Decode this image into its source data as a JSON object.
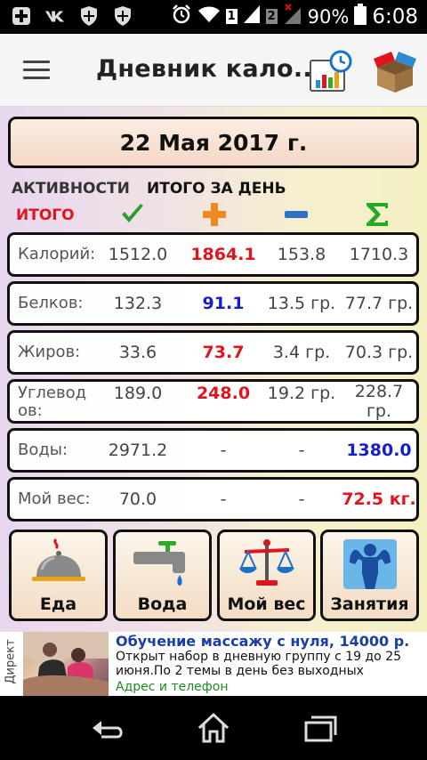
{
  "status_bar": {
    "sim1_badge": "1",
    "sim2_badge": "2",
    "battery": "90%",
    "time": "6:08"
  },
  "app_bar": {
    "title": "Дневник кало..."
  },
  "date": "22 Мая 2017 г.",
  "tabs": {
    "activities": "АКТИВНОСТИ",
    "day_total": "ИТОГО ЗА ДЕНЬ"
  },
  "total_label": "ИТОГО",
  "column_icons": [
    "check-icon",
    "plus-icon",
    "minus-icon",
    "sigma-icon"
  ],
  "rows": [
    {
      "label": "Калорий:",
      "values": [
        "1512.0",
        "1864.1",
        "153.8",
        "1710.3"
      ],
      "colors": [
        "",
        "red",
        "",
        ""
      ]
    },
    {
      "label": "Белков:",
      "values": [
        "132.3",
        "91.1",
        "13.5 гр.",
        "77.7 гр."
      ],
      "colors": [
        "",
        "blue",
        "",
        ""
      ]
    },
    {
      "label": "Жиров:",
      "values": [
        "33.6",
        "73.7",
        "3.4 гр.",
        "70.3 гр."
      ],
      "colors": [
        "",
        "red",
        "",
        ""
      ]
    },
    {
      "label_line1": "Углевод",
      "label_line2": "ов:",
      "values": [
        "189.0",
        "248.0",
        "19.2 гр.",
        "228.7"
      ],
      "value4_line2": "гр.",
      "colors": [
        "",
        "red",
        "",
        ""
      ]
    },
    {
      "label": "Воды:",
      "values": [
        "2971.2",
        "-",
        "-",
        "1380.0"
      ],
      "colors": [
        "",
        "",
        "",
        "blue"
      ]
    },
    {
      "label": "Мой вес:",
      "values": [
        "70.0",
        "-",
        "-",
        "72.5 кг."
      ],
      "colors": [
        "",
        "",
        "",
        "red"
      ]
    }
  ],
  "buttons": {
    "food": "Еда",
    "water": "Вода",
    "weight": "Мой вес",
    "exercise": "Занятия"
  },
  "ad": {
    "tag": "Директ",
    "title": "Обучение массажу с нуля, 14000 р.",
    "text": "Открыт набор в дневную группу с 19 до 25 июня.По 2 темы в день без выходных",
    "link": "Адрес и телефон"
  },
  "colors": {
    "red_value": "#e0141e",
    "blue_value": "#1720c8",
    "green_check": "#2e9b2e",
    "orange_plus": "#f08a1e",
    "blue_minus": "#2a73c8",
    "green_sigma": "#22aa22"
  }
}
